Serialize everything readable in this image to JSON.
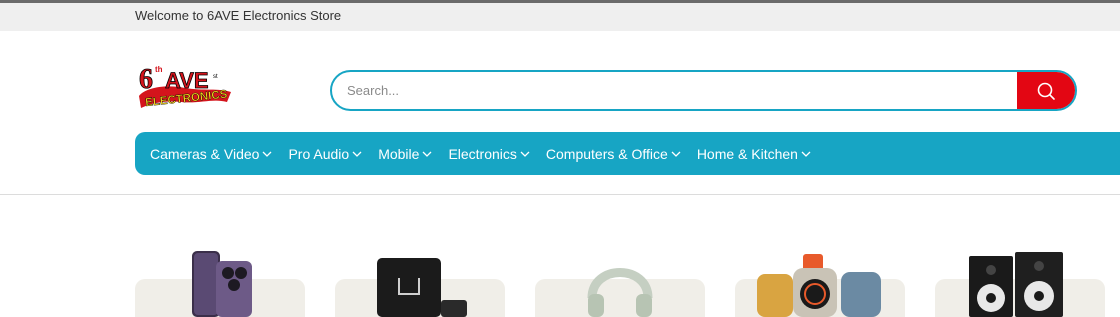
{
  "store": {
    "welcome_text": "Welcome to 6AVE Electronics Store",
    "logo_text_top": "6",
    "logo_text_sup": "th",
    "logo_text_ave": "AVE",
    "logo_text_bottom": "ELECTRONICS"
  },
  "search": {
    "placeholder": "Search..."
  },
  "nav": {
    "items": [
      {
        "label": "Cameras & Video"
      },
      {
        "label": "Pro Audio"
      },
      {
        "label": "Mobile"
      },
      {
        "label": "Electronics"
      },
      {
        "label": "Computers & Office"
      },
      {
        "label": "Home & Kitchen"
      }
    ]
  },
  "colors": {
    "accent": "#17a5c4",
    "search_button": "#e30613",
    "topbar": "#efefef",
    "card": "#f0eee8"
  },
  "icons": {
    "search": "search-icon",
    "chevron": "chevron-down-icon"
  }
}
